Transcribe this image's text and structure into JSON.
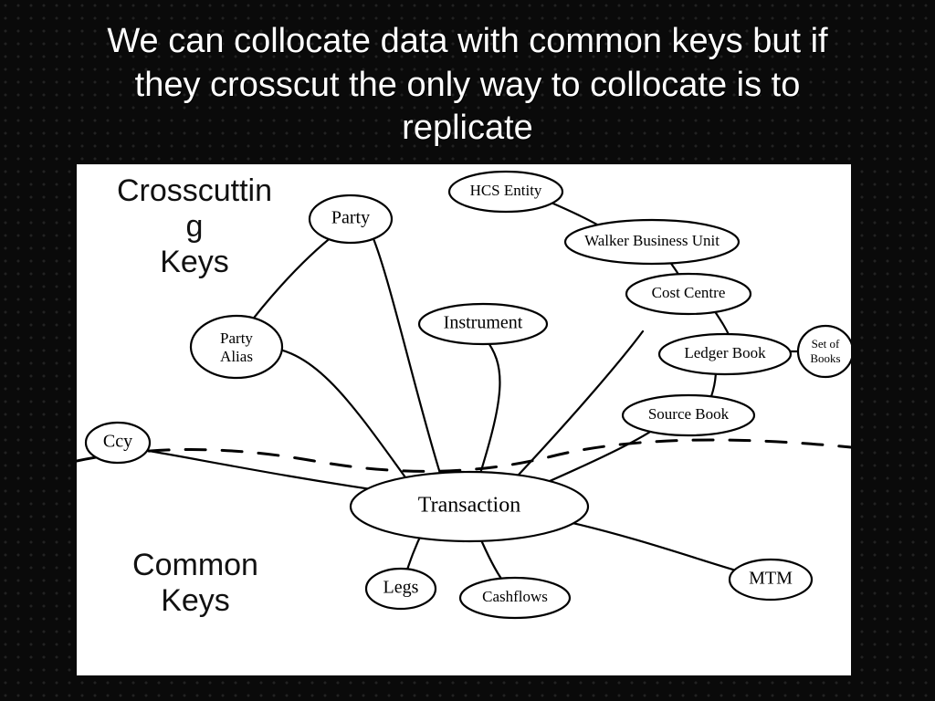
{
  "title": {
    "line1": "We can collocate data with common keys but if",
    "line2": "they crosscut the only way to collocate is to",
    "line3": "replicate"
  },
  "labels": {
    "crosscutting": "Crosscuttin\ng\nKeys",
    "common": "Common\nKeys"
  },
  "nodes": {
    "ccy": "Ccy",
    "party": "Party",
    "party_alias": "Party\nAlias",
    "hcs_entity": "HCS Entity",
    "walker_bu": "Walker Business Unit",
    "cost_centre": "Cost Centre",
    "instrument": "Instrument",
    "ledger_book": "Ledger Book",
    "set_of_books": "Set of\nBooks",
    "source_book": "Source Book",
    "transaction": "Transaction",
    "legs": "Legs",
    "cashflows": "Cashflows",
    "mtm": "MTM"
  }
}
